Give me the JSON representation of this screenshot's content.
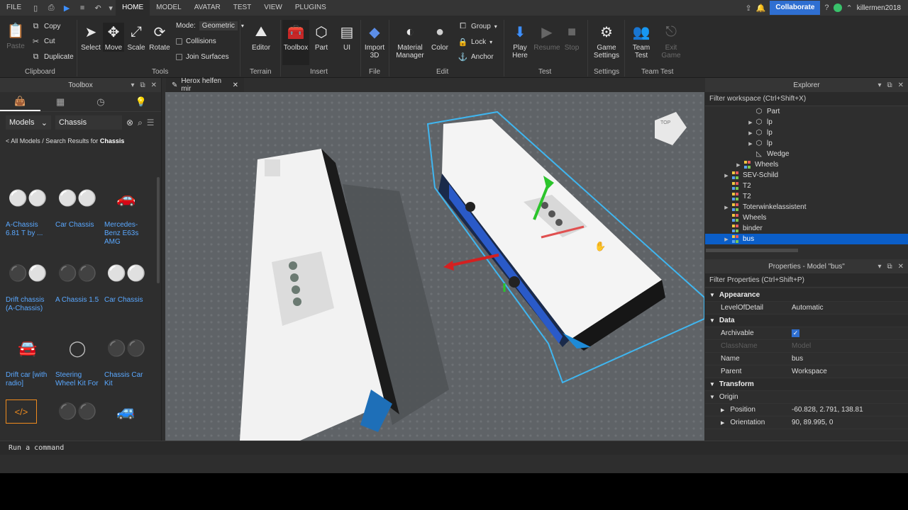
{
  "menubar": {
    "file": "FILE",
    "tabs": [
      "HOME",
      "MODEL",
      "AVATAR",
      "TEST",
      "VIEW",
      "PLUGINS"
    ],
    "collaborate": "Collabor­ate",
    "username": "killermen2018"
  },
  "ribbon": {
    "clipboard": {
      "paste": "Paste",
      "copy": "Copy",
      "cut": "Cut",
      "duplicate": "Duplicate",
      "group": "Clipboard"
    },
    "tools": {
      "select": "Select",
      "move": "Move",
      "scale": "Scale",
      "rotate": "Rotate",
      "mode_label": "Mode:",
      "mode_value": "Geometric",
      "collisions": "Collisions",
      "join_surfaces": "Join Surfaces",
      "group": "Tools"
    },
    "terrain": {
      "editor": "Editor",
      "group": "Terrain"
    },
    "insert": {
      "toolbox": "Toolbox",
      "part": "Part",
      "ui": "UI",
      "group": "Insert"
    },
    "file": {
      "import": "Import",
      "import2": "3D",
      "group": "File"
    },
    "edit": {
      "material": "Material",
      "manager": "Manager",
      "color": "Color",
      "group_btn": "Group",
      "lock": "Lock",
      "anchor": "Anchor",
      "group": "Edit"
    },
    "test": {
      "play": "Play",
      "here": "Here",
      "resume": "Resume",
      "stop": "Stop",
      "group": "Test"
    },
    "settings": {
      "game": "Game",
      "settings": "Settings",
      "group": "Settings"
    },
    "teamtest": {
      "team": "Team",
      "test": "Test",
      "exit": "Exit",
      "game": "Game",
      "group": "Team Test"
    }
  },
  "toolbox": {
    "title": "Toolbox",
    "category": "Models",
    "search_value": "Chassis",
    "breadcrumb_prefix": "< All Models / Search Results for",
    "breadcrumb_term": "Chassis",
    "items": [
      {
        "label": "A-Chassis 6.81 T by ...",
        "icon": "chassis-parts"
      },
      {
        "label": "Car Chassis",
        "icon": "chassis-parts"
      },
      {
        "label": "Mercedes-Benz E63s AMG",
        "icon": "car"
      },
      {
        "label": "Drift chassis (A-Chassis)",
        "icon": "chassis-parts"
      },
      {
        "label": "A Chassis 1.5",
        "icon": "chassis-parts"
      },
      {
        "label": "Car Chassis",
        "icon": "chassis-parts"
      },
      {
        "label": "Drift car [with radio]",
        "icon": "car"
      },
      {
        "label": "Steering Wheel Kit For",
        "icon": "steering-wheel"
      },
      {
        "label": "Chassis Car Kit",
        "icon": "chassis-parts"
      },
      {
        "label": "",
        "icon": "script"
      },
      {
        "label": "",
        "icon": "chassis-parts"
      },
      {
        "label": "",
        "icon": "car"
      }
    ]
  },
  "viewport": {
    "tab_title": "Herox helfen mir"
  },
  "explorer": {
    "title": "Explorer",
    "filter_placeholder": "Filter workspace (Ctrl+Shift+X)",
    "rows": [
      {
        "label": "Part",
        "indent": 4,
        "arrow": false,
        "icon": "part-icon",
        "selected": false
      },
      {
        "label": "lp",
        "indent": 4,
        "arrow": true,
        "icon": "part-icon",
        "selected": false
      },
      {
        "label": "lp",
        "indent": 4,
        "arrow": true,
        "icon": "part-icon",
        "selected": false
      },
      {
        "label": "lp",
        "indent": 4,
        "arrow": true,
        "icon": "part-icon",
        "selected": false
      },
      {
        "label": "Wedge",
        "indent": 4,
        "arrow": false,
        "icon": "wedge-icon",
        "selected": false
      },
      {
        "label": "Wheels",
        "indent": 3,
        "arrow": true,
        "icon": "model-icon",
        "selected": false
      },
      {
        "label": "SEV-Schild",
        "indent": 2,
        "arrow": true,
        "icon": "model-icon",
        "selected": false
      },
      {
        "label": "T2",
        "indent": 2,
        "arrow": false,
        "icon": "model-icon",
        "selected": false
      },
      {
        "label": "T2",
        "indent": 2,
        "arrow": false,
        "icon": "model-icon",
        "selected": false
      },
      {
        "label": "Toterwinkelassistent",
        "indent": 2,
        "arrow": true,
        "icon": "model-icon",
        "selected": false
      },
      {
        "label": "Wheels",
        "indent": 2,
        "arrow": false,
        "icon": "model-icon",
        "selected": false
      },
      {
        "label": "binder",
        "indent": 2,
        "arrow": false,
        "icon": "model-icon",
        "selected": false
      },
      {
        "label": "bus",
        "indent": 2,
        "arrow": true,
        "icon": "model-icon",
        "selected": true
      }
    ]
  },
  "properties": {
    "title": "Properties - Model \"bus\"",
    "filter_placeholder": "Filter Properties (Ctrl+Shift+P)",
    "rows": [
      {
        "type": "cat",
        "key": "Appearance",
        "value": ""
      },
      {
        "type": "prop",
        "key": "LevelOfDetail",
        "value": "Automatic"
      },
      {
        "type": "cat",
        "key": "Data",
        "value": ""
      },
      {
        "type": "check",
        "key": "Archivable",
        "value": ""
      },
      {
        "type": "dis",
        "key": "ClassName",
        "value": "Model"
      },
      {
        "type": "prop",
        "key": "Name",
        "value": "bus"
      },
      {
        "type": "prop",
        "key": "Parent",
        "value": "Workspace"
      },
      {
        "type": "cat",
        "key": "Transform",
        "value": ""
      },
      {
        "type": "sub",
        "key": "Origin",
        "value": ""
      },
      {
        "type": "sub2",
        "key": "Position",
        "value": "-60.828, 2.791, 138.81"
      },
      {
        "type": "sub2",
        "key": "Orientation",
        "value": "90, 89.995, 0"
      }
    ]
  },
  "command_bar": {
    "placeholder": "Run a command"
  }
}
